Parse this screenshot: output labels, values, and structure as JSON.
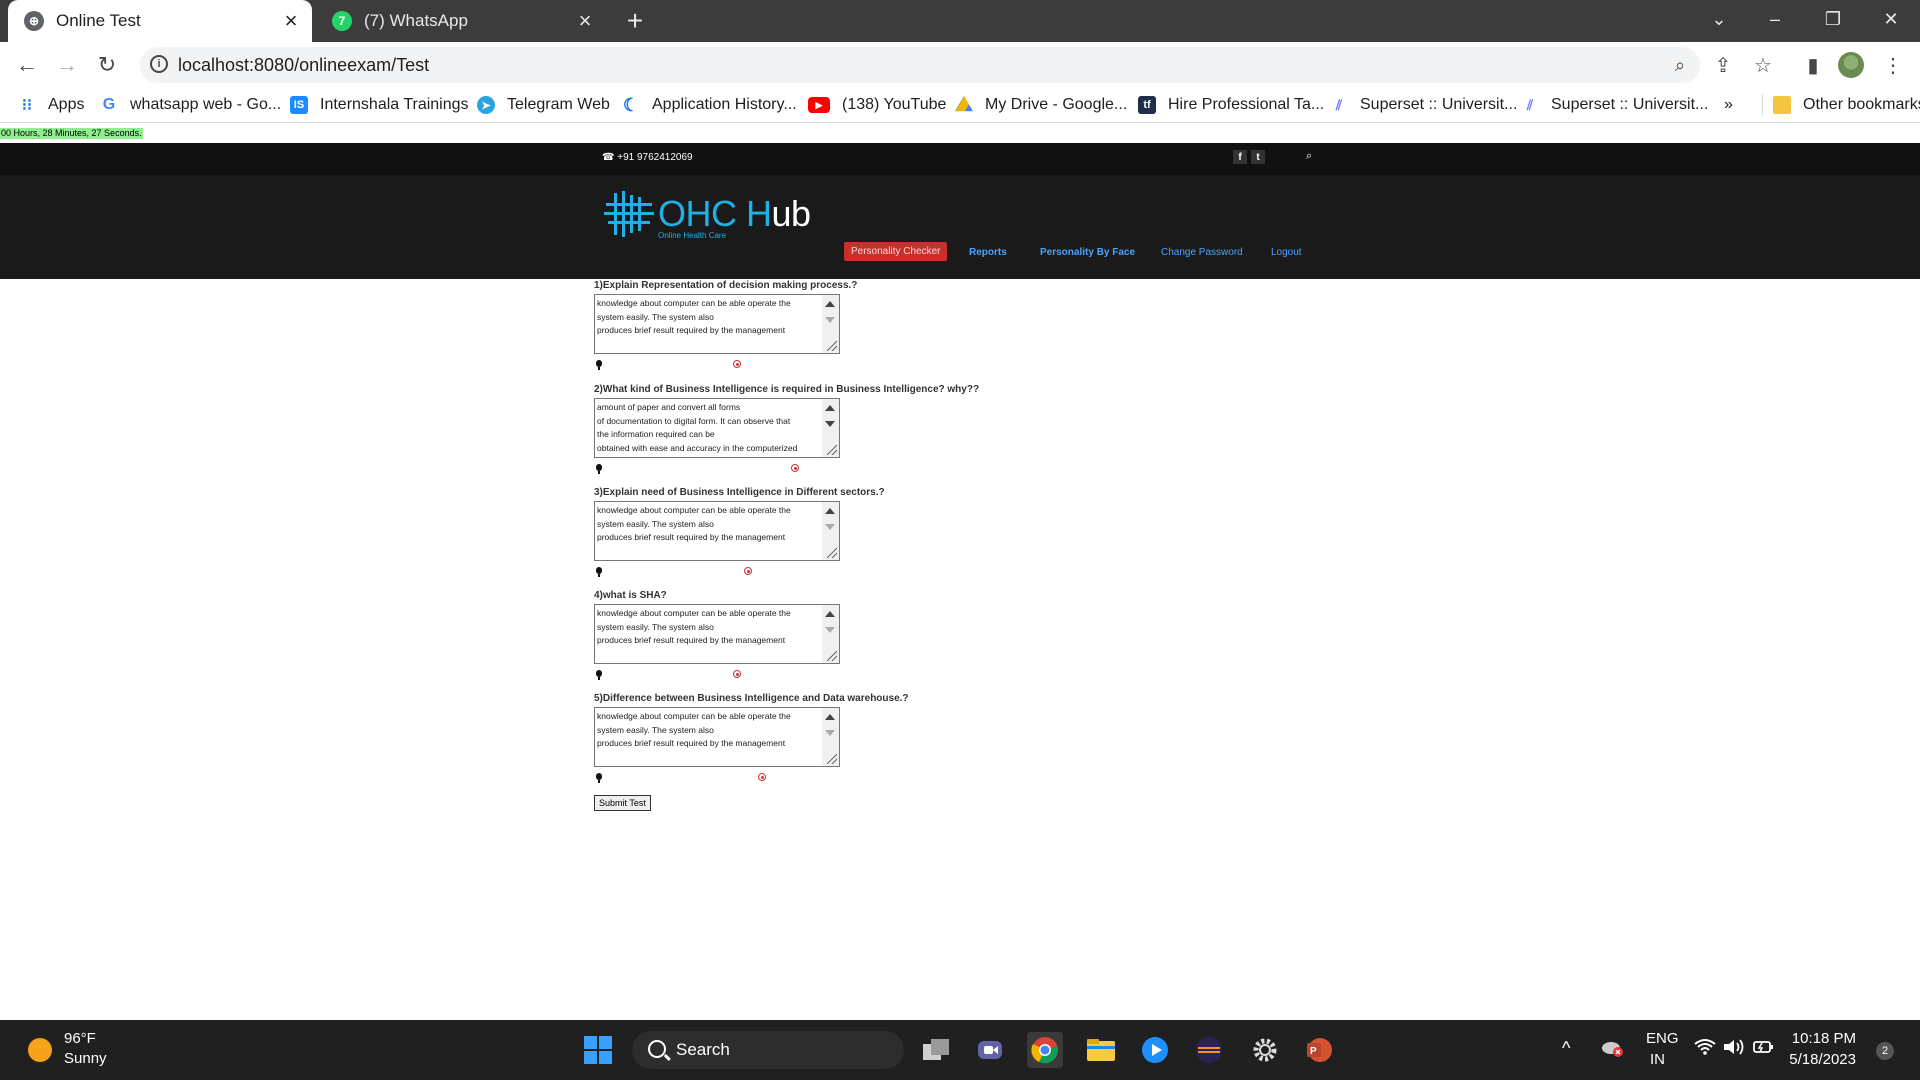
{
  "browser": {
    "tabs": [
      {
        "title": "Online Test",
        "active": true
      },
      {
        "title": "(7) WhatsApp",
        "active": false
      }
    ],
    "whatsapp_badge": "7",
    "url": "localhost:8080/onlineexam/Test",
    "bookmarks": [
      {
        "label": "Apps",
        "icon": "apps-grid-icon"
      },
      {
        "label": "whatsapp web - Go...",
        "icon": "google-icon"
      },
      {
        "label": "Internshala Trainings",
        "icon": "internshala-icon"
      },
      {
        "label": "Telegram Web",
        "icon": "telegram-icon"
      },
      {
        "label": "Application History...",
        "icon": "application-icon"
      },
      {
        "label": "(138) YouTube",
        "icon": "youtube-icon"
      },
      {
        "label": "My Drive - Google...",
        "icon": "google-drive-icon"
      },
      {
        "label": "Hire Professional Ta...",
        "icon": "tf-icon"
      },
      {
        "label": "Superset :: Universit...",
        "icon": "superset-icon"
      },
      {
        "label": "Superset :: Universit...",
        "icon": "superset-icon"
      }
    ],
    "more_bookmarks": "»",
    "other_bookmarks": "Other bookmarks"
  },
  "page": {
    "timer": "00 Hours, 28 Minutes, 27 Seconds.",
    "phone": "+91 9762412069",
    "social": [
      "f",
      "t"
    ],
    "logo": {
      "ohc": "OHC H",
      "hub": "ub",
      "subtitle": "Online Health Care"
    },
    "nav": {
      "personality_checker": "Personality Checker",
      "reports": "Reports",
      "personality_by_face": "Personality By Face",
      "change_password": "Change Password",
      "logout": "Logout"
    },
    "questions": [
      {
        "label": "1)Explain Representation of decision making process.?",
        "answer": "knowledge about computer can be able operate the\nsystem easily. The system also\nproduces brief result required by the management"
      },
      {
        "label": "2)What kind of Business Intelligence is required in Business Intelligence? why??",
        "answer": "amount of paper and convert all forms\nof documentation to digital form. It can observe that\nthe information required can be\nobtained with ease and accuracy in the computerized"
      },
      {
        "label": "3)Explain need of Business Intelligence in Different sectors.?",
        "answer": "knowledge about computer can be able operate the\nsystem easily. The system also\nproduces brief result required by the management"
      },
      {
        "label": "4)what is SHA?",
        "answer": "knowledge about computer can be able operate the\nsystem easily. The system also\nproduces brief result required by the management"
      },
      {
        "label": "5)Difference between Business Intelligence and Data warehouse.?",
        "answer": "knowledge about computer can be able operate the\nsystem easily. The system also\nproduces brief result required by the management"
      }
    ],
    "submit_label": "Submit Test"
  },
  "taskbar": {
    "weather_temp": "96°F",
    "weather_desc": "Sunny",
    "search_label": "Search",
    "lang": "ENG",
    "region": "IN",
    "time": "10:18 PM",
    "date": "5/18/2023",
    "notification_count": "2"
  }
}
